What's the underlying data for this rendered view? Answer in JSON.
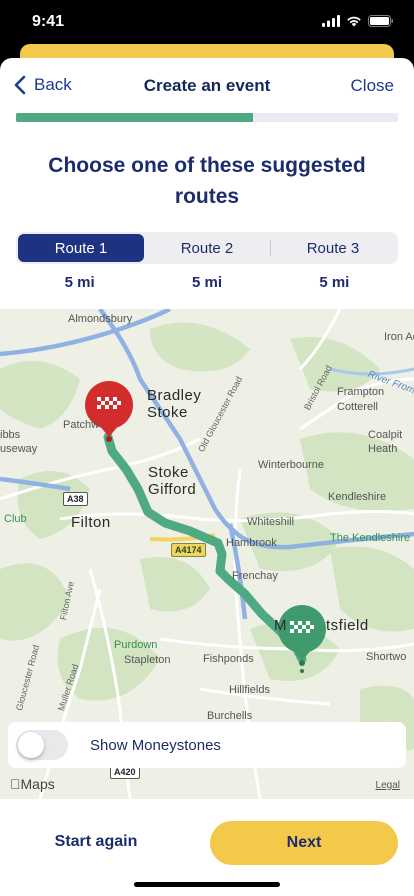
{
  "status": {
    "time": "9:41"
  },
  "nav": {
    "back_label": "Back",
    "title": "Create an event",
    "close_label": "Close"
  },
  "progress": {
    "fraction": 0.62
  },
  "heading": "Choose one of these suggested routes",
  "routes": [
    {
      "label": "Route 1",
      "distance": "5 mi",
      "selected": true
    },
    {
      "label": "Route 2",
      "distance": "5 mi",
      "selected": false
    },
    {
      "label": "Route 3",
      "distance": "5 mi",
      "selected": false
    }
  ],
  "map": {
    "labels": {
      "almondsbury": "Almondsbury",
      "iron_acton": "Iron Ac",
      "bradley": "Bradley",
      "stoke": "Stoke",
      "patchway": "Patchw",
      "gibbs": "ibbs",
      "causeway": "useway",
      "stoke2": "Stoke",
      "gifford": "Gifford",
      "frampton": "Frampton",
      "cotterell": "Cotterell",
      "coalpit": "Coalpit",
      "heath": "Heath",
      "winterbourne": "Winterbourne",
      "kendleshire": "Kendleshire",
      "the_kendleshire": "The Kendleshire",
      "whiteshill": "Whiteshill",
      "hambrook": "Hambrook",
      "frenchay": "Frenchay",
      "filton": "Filton",
      "club": "Club",
      "mangotsfield_a": "M",
      "mangotsfield_b": "tsfield",
      "shortwood": "Shortwo",
      "purdown": "Purdown",
      "stapleton": "Stapleton",
      "fishponds": "Fishponds",
      "hillfields": "Hillfields",
      "burchells": "Burchells",
      "old_gloucester_rd": "Old Gloucester Road",
      "bristol_rd": "Bristol Road",
      "filton_ave": "Filton Ave",
      "gloucester_rd": "Gloucester Road",
      "muller_rd": "Muller Road",
      "river_frome": "River Frome"
    },
    "badges": {
      "a38": "A38",
      "a4174": "A4174",
      "a420": "A420"
    },
    "show_moneystones_label": "Show Moneystones",
    "show_moneystones_on": false,
    "attribution": "Maps",
    "legal": "Legal",
    "start_icon": "checkered-flag-icon",
    "end_icon": "checkered-flag-icon",
    "colors": {
      "start_pin": "#d32c2c",
      "end_pin": "#3f9a6e",
      "route": "#4fa983",
      "primary": "#1d3280",
      "accent": "#f4c94a"
    }
  },
  "footer": {
    "start_again_label": "Start again",
    "next_label": "Next"
  }
}
